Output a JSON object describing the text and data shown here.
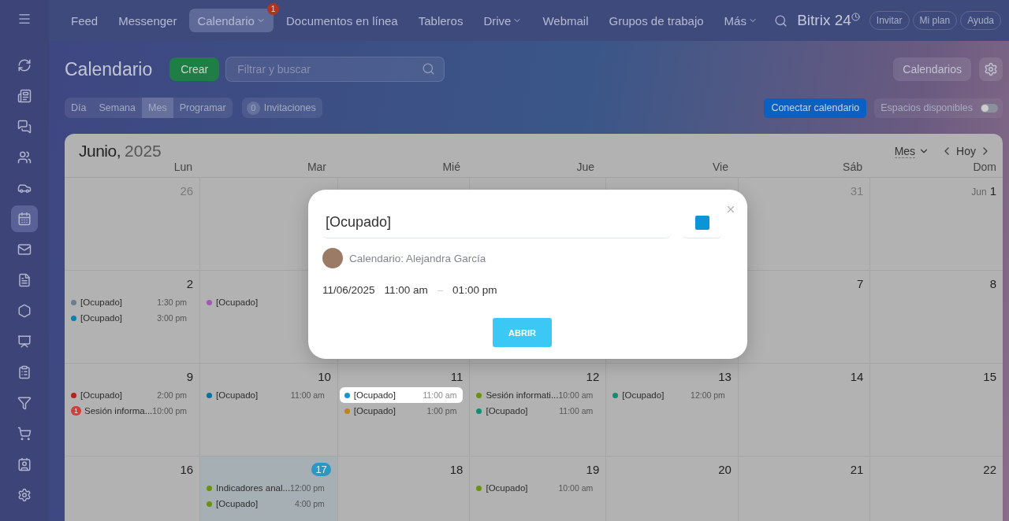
{
  "nav": {
    "items": [
      {
        "label": "Feed",
        "selected": false,
        "dropdown": false
      },
      {
        "label": "Messenger",
        "selected": false,
        "dropdown": false
      },
      {
        "label": "Calendario",
        "selected": true,
        "dropdown": true,
        "badge": "1"
      },
      {
        "label": "Documentos en línea",
        "selected": false,
        "dropdown": false
      },
      {
        "label": "Tableros",
        "selected": false,
        "dropdown": false
      },
      {
        "label": "Drive",
        "selected": false,
        "dropdown": true
      },
      {
        "label": "Webmail",
        "selected": false,
        "dropdown": false
      },
      {
        "label": "Grupos de trabajo",
        "selected": false,
        "dropdown": false
      },
      {
        "label": "Más",
        "selected": false,
        "dropdown": true
      }
    ],
    "brand": "Bitrix 24",
    "buttons": [
      "Invitar",
      "Mi plan",
      "Ayuda"
    ]
  },
  "sidebar": {
    "items": [
      {
        "selected": false
      },
      {
        "selected": false
      },
      {
        "selected": false
      },
      {
        "selected": false
      },
      {
        "selected": false
      },
      {
        "selected": true
      },
      {
        "selected": false
      },
      {
        "selected": false
      },
      {
        "selected": false
      },
      {
        "selected": false
      },
      {
        "selected": false
      },
      {
        "selected": false
      },
      {
        "selected": false
      },
      {
        "selected": false
      },
      {
        "selected": false
      }
    ]
  },
  "header": {
    "title": "Calendario",
    "create": "Crear",
    "search": {
      "placeholder": "Filtrar y buscar"
    },
    "calendars": "Calendarios"
  },
  "views": [
    {
      "label": "Día",
      "selected": false
    },
    {
      "label": "Semana",
      "selected": false
    },
    {
      "label": "Mes",
      "selected": true
    },
    {
      "label": "Programar",
      "selected": false
    }
  ],
  "invitations": {
    "count": "0",
    "label": "Invitaciones"
  },
  "connect": "Conectar calendario",
  "availability": {
    "label": "Espacios disponibles",
    "on": false
  },
  "calendar": {
    "month": "Junio,",
    "year": "2025",
    "view": "Mes",
    "today": "Hoy",
    "weekdays": [
      "Lun",
      "Mar",
      "Mié",
      "Jue",
      "Vie",
      "Sáb",
      "Dom"
    ],
    "weeks": [
      {
        "left": [
          {
            "date": "26",
            "muted": true
          }
        ],
        "right": [
          {
            "date": "31",
            "muted": true
          },
          {
            "date": "1",
            "month_label": "Jun",
            "muted": false
          }
        ]
      },
      {
        "left": [
          {
            "date": "2",
            "muted": false,
            "events": [
              {
                "kind": "dot",
                "color": "#6e7d8c",
                "title": "[Ocupado]",
                "time": "1:30 pm",
                "selected": false
              },
              {
                "kind": "dot",
                "color": "#0b7fae",
                "title": "[Ocupado]",
                "time": "3:00 pm",
                "selected": false
              }
            ]
          },
          {
            "events": [
              {
                "kind": "dot",
                "color": "#a05cb0",
                "title": "[Ocupado]",
                "selected": false
              }
            ]
          }
        ],
        "right": [
          {
            "date": "7",
            "muted": false
          },
          {
            "date": "8",
            "muted": false
          }
        ]
      },
      {
        "left": [
          {
            "date": "9",
            "muted": false,
            "events": [
              {
                "kind": "dot",
                "color": "#b3231f",
                "title": "[Ocupado]",
                "time": "2:00 pm",
                "selected": false
              },
              {
                "kind": "badge",
                "color": "#c8413b",
                "badge": "1",
                "title": "Sesión informa...",
                "time": "10:00 pm",
                "selected": false
              }
            ]
          },
          {
            "date": "10",
            "muted": false,
            "events": [
              {
                "kind": "dot",
                "color": "#0b6f9e",
                "title": "[Ocupado]",
                "time": "11:00 am",
                "selected": false
              }
            ]
          },
          {
            "date": "11",
            "muted": false,
            "events": [
              {
                "kind": "dot",
                "color": "#1596cf",
                "title": "[Ocupado]",
                "time": "11:00 am",
                "selected": true
              },
              {
                "kind": "dot",
                "color": "#bf860f",
                "title": "[Ocupado]",
                "time": "1:00 pm",
                "selected": false
              }
            ]
          },
          {
            "date": "12",
            "muted": false,
            "events": [
              {
                "kind": "dot",
                "color": "#6a9210",
                "title": "Sesión informati...",
                "time": "10:00 am",
                "selected": false
              },
              {
                "kind": "dot",
                "color": "#128c72",
                "title": "[Ocupado]",
                "time": "11:00 am",
                "selected": false
              }
            ]
          },
          {
            "date": "13",
            "muted": false,
            "events": [
              {
                "kind": "dot",
                "color": "#128c72",
                "title": "[Ocupado]",
                "time": "12:00 pm",
                "selected": false
              }
            ]
          },
          {
            "date": "14",
            "muted": false
          },
          {
            "date": "15",
            "muted": false
          }
        ]
      },
      {
        "left": [
          {
            "date": "16",
            "muted": false
          },
          {
            "date": "17",
            "muted": false,
            "today": true,
            "events": [
              {
                "kind": "dot",
                "color": "#6a9210",
                "title": "Indicadores anal...",
                "time": "12:00 pm",
                "selected": false
              },
              {
                "kind": "dot",
                "color": "#6a9210",
                "title": "[Ocupado]",
                "time": "4:00 pm",
                "selected": false
              }
            ]
          },
          {
            "date": "18",
            "muted": false
          },
          {
            "date": "19",
            "muted": false,
            "events": [
              {
                "kind": "dot",
                "color": "#6a9210",
                "title": "[Ocupado]",
                "time": "10:00 am",
                "selected": false
              }
            ]
          },
          {
            "date": "20",
            "muted": false
          },
          {
            "date": "21",
            "muted": false
          },
          {
            "date": "22",
            "muted": false
          }
        ]
      }
    ]
  },
  "popup": {
    "title": "[Ocupado]",
    "color": "#0a96d4",
    "owner": "Calendario: Alejandra García",
    "date": "11/06/2025",
    "start": "11:00 am",
    "separator": "–",
    "end": "01:00 pm",
    "button": "ABRIR"
  }
}
